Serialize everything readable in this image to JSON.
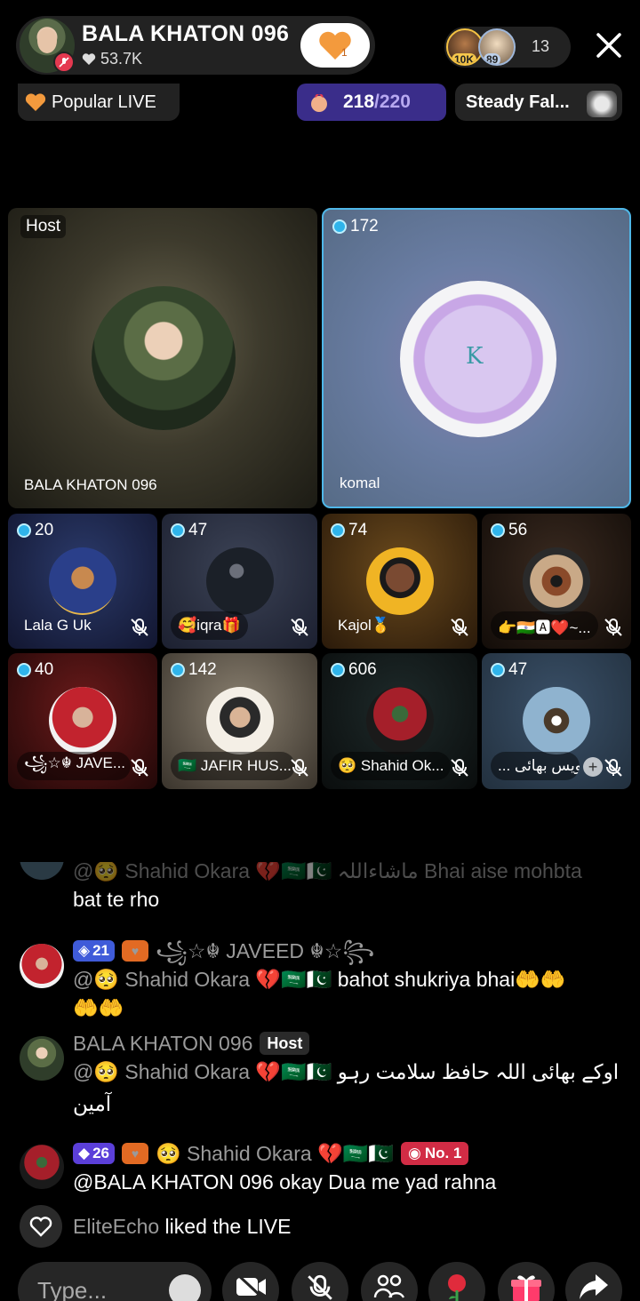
{
  "host": {
    "name": "BALA KHATON 096",
    "likes": "53.7K",
    "follow_count": "1"
  },
  "viewers": {
    "badge1": "10K",
    "badge2": "89",
    "count": "13"
  },
  "popular_live": "Popular LIVE",
  "goal": {
    "current": "218",
    "total": "/220"
  },
  "steady": "Steady Fal...",
  "tiles": [
    {
      "tag": "Host",
      "label": "BALA KHATON 096"
    },
    {
      "count": "172",
      "label": "komal"
    },
    {
      "count": "20",
      "label": "Lala G Uk"
    },
    {
      "count": "47",
      "label": "🥰iqra🎁"
    },
    {
      "count": "74",
      "label": "Kajol🥇"
    },
    {
      "count": "56",
      "label": "👉🇮🇳🅰❤️~..."
    },
    {
      "count": "40",
      "label": "꧁☆☬ JAVE..."
    },
    {
      "count": "142",
      "label": "🇸🇦 JAFIR HUS..."
    },
    {
      "count": "606",
      "label": "🥺 Shahid Ok..."
    },
    {
      "count": "47",
      "label": "... اویس بھائی"
    }
  ],
  "chat": [
    {
      "text_faded": "@🥺 Shahid Okara 💔🇸🇦🇵🇰 ماشاءاللہ Bhai aise mohbta",
      "text": "bat te rho"
    },
    {
      "level": "21",
      "name": "꧁☆☬ JAVEED ☬☆꧂",
      "mention": "@🥺 Shahid Okara 💔🇸🇦🇵🇰",
      "text": " bahot shukriya bhai🤲🤲",
      "text2": "🤲🤲"
    },
    {
      "name": "BALA KHATON 096",
      "tag": "Host",
      "mention": "@🥺 Shahid Okara 💔🇸🇦🇵🇰",
      "text": " اوکے بھائی اللہ حافظ سلامت رہو",
      "text2": "آمین"
    },
    {
      "level": "26",
      "name": "🥺 Shahid Okara 💔🇸🇦🇵🇰",
      "rank": "No. 1",
      "text": "@BALA KHATON 096 okay Dua me yad rahna"
    }
  ],
  "liked": {
    "user": "EliteEcho",
    "text": " liked the LIVE"
  },
  "input": {
    "placeholder": "Type..."
  },
  "colors": {
    "accent_goal": "#3a2d8a",
    "diamond": "#2fb4ea",
    "mute_red": "#e53950"
  }
}
